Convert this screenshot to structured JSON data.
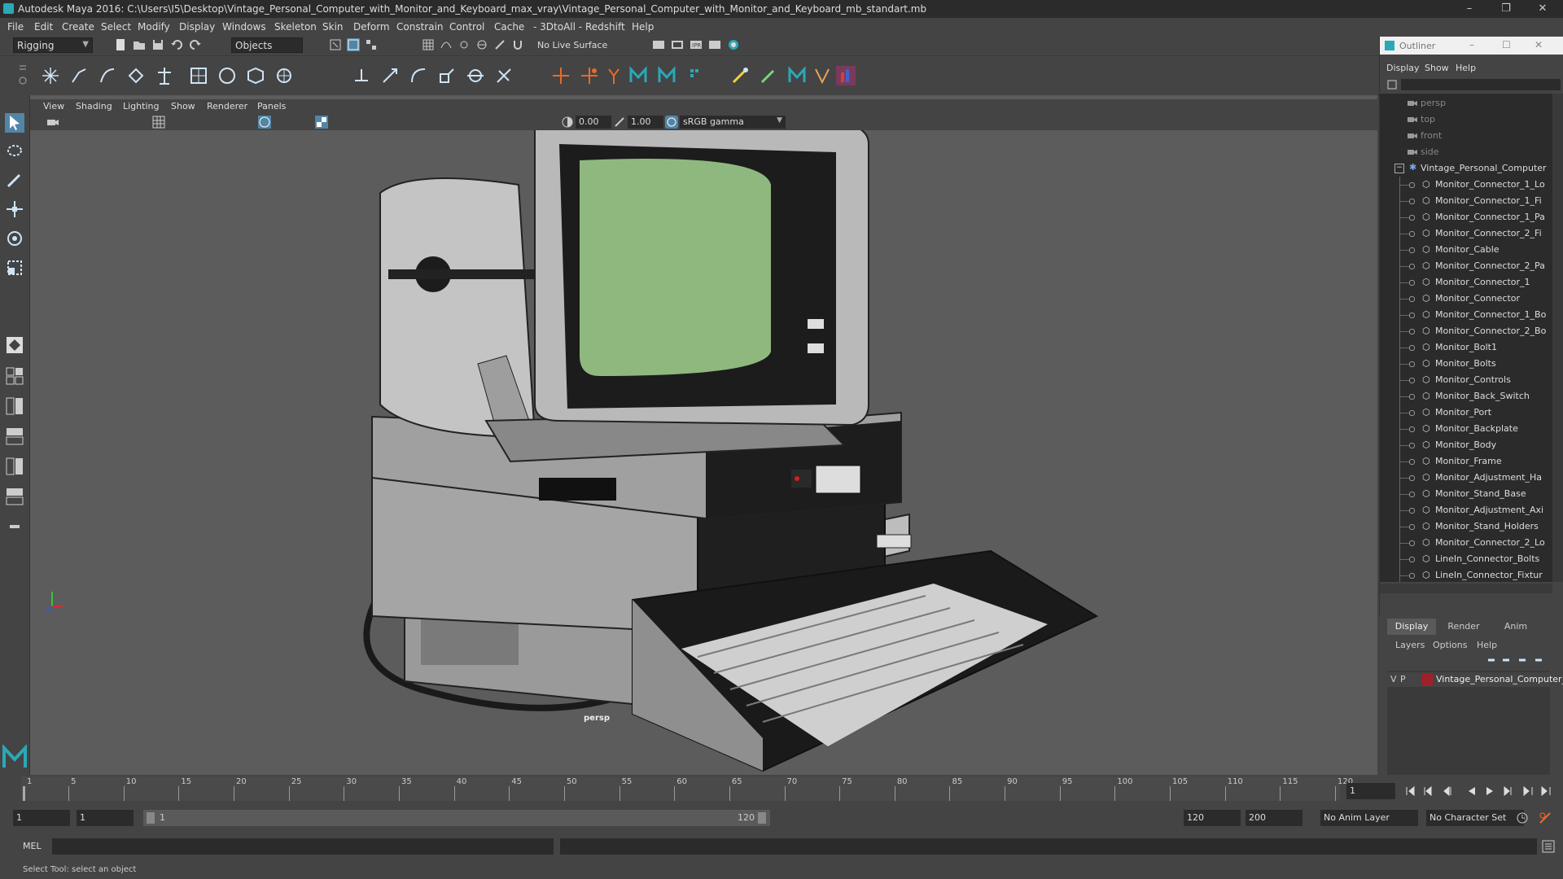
{
  "window": {
    "title": "Autodesk Maya 2016: C:\\Users\\I5\\Desktop\\Vintage_Personal_Computer_with_Monitor_and_Keyboard_max_vray\\Vintage_Personal_Computer_with_Monitor_and_Keyboard_mb_standart.mb",
    "minimize": "–",
    "restore": "❐",
    "close": "✕"
  },
  "menubar": [
    "File",
    "Edit",
    "Create",
    "Select",
    "Modify",
    "Display",
    "Windows",
    "Skeleton",
    "Skin",
    "Deform",
    "Constrain",
    "Control",
    "Cache",
    "- 3DtoAll -",
    "Redshift",
    "Help"
  ],
  "statusline": {
    "mode": "Rigging",
    "selection_mask": "Objects",
    "live_surface": "No Live Surface"
  },
  "viewport": {
    "menus": [
      "View",
      "Shading",
      "Lighting",
      "Show",
      "Renderer",
      "Panels"
    ],
    "exposure": "0.00",
    "gamma": "1.00",
    "colorspace": "sRGB gamma",
    "camera_label": "persp",
    "screen_text_color": "#8fb87f"
  },
  "outliner": {
    "title": "Outliner",
    "menus": [
      "Display",
      "Show",
      "Help"
    ],
    "cameras": [
      "persp",
      "top",
      "front",
      "side"
    ],
    "group": "Vintage_Personal_Computer",
    "items": [
      "Monitor_Connector_1_Lo",
      "Monitor_Connector_1_Fi",
      "Monitor_Connector_1_Pa",
      "Monitor_Connector_2_Fi",
      "Monitor_Cable",
      "Monitor_Connector_2_Pa",
      "Monitor_Connector_1",
      "Monitor_Connector",
      "Monitor_Connector_1_Bo",
      "Monitor_Connector_2_Bo",
      "Monitor_Bolt1",
      "Monitor_Bolts",
      "Monitor_Controls",
      "Monitor_Back_Switch",
      "Monitor_Port",
      "Monitor_Backplate",
      "Monitor_Body",
      "Monitor_Frame",
      "Monitor_Adjustment_Ha",
      "Monitor_Stand_Base",
      "Monitor_Adjustment_Axi",
      "Monitor_Stand_Holders",
      "Monitor_Connector_2_Lo",
      "LineIn_Connector_Bolts",
      "LineIn_Connector_Fixtur"
    ]
  },
  "layer_editor": {
    "tabs": [
      "Display",
      "Render",
      "Anim"
    ],
    "menus": [
      "Layers",
      "Options",
      "Help"
    ],
    "layer": {
      "v": "V",
      "p": "P",
      "name": "Vintage_Personal_Computer_",
      "color": "#a0202a"
    }
  },
  "timeline": {
    "ticks": [
      "1",
      "5",
      "10",
      "15",
      "20",
      "25",
      "30",
      "35",
      "40",
      "45",
      "50",
      "55",
      "60",
      "65",
      "70",
      "75",
      "80",
      "85",
      "90",
      "95",
      "100",
      "105",
      "110",
      "115",
      "120"
    ],
    "current_frame": "1"
  },
  "range": {
    "start": "1",
    "playback_start": "1",
    "slider_start": "1",
    "slider_end": "120",
    "playback_end": "120",
    "end": "200",
    "anim_layer": "No Anim Layer",
    "character_set": "No Character Set"
  },
  "cmdline": {
    "label": "MEL"
  },
  "helpline": {
    "text": "Select Tool: select an object"
  }
}
